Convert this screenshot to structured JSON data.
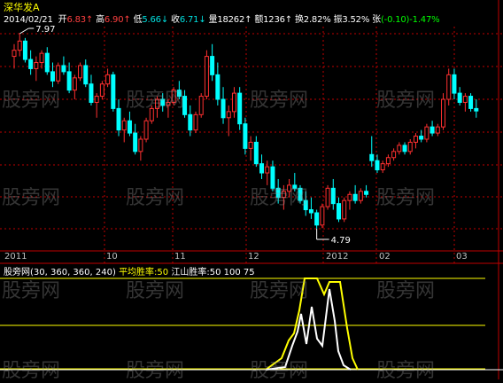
{
  "stock": {
    "name": "深华发A",
    "date": "2014/02/21"
  },
  "quote": [
    {
      "label": "开",
      "value": "6.83",
      "arrow": "↑",
      "color": "#ff4040"
    },
    {
      "label": "高",
      "value": "6.90",
      "arrow": "↑",
      "color": "#ff4040"
    },
    {
      "label": "低",
      "value": "5.66",
      "arrow": "↓",
      "color": "#00e0e0"
    },
    {
      "label": "收",
      "value": "6.71",
      "arrow": "↓",
      "color": "#00e0e0"
    },
    {
      "label": "量",
      "value": "18262",
      "arrow": "↑",
      "color": "#ffffff"
    },
    {
      "label": "额",
      "value": "1236",
      "arrow": "↑",
      "color": "#ffffff"
    },
    {
      "label": "换",
      "value": "2.82%",
      "arrow": "",
      "color": "#ffffff"
    },
    {
      "label": "振",
      "value": "3.52%",
      "arrow": "",
      "color": "#ffffff"
    },
    {
      "label": "张",
      "value": "(-0.10)-1.47%",
      "arrow": "",
      "color": "#00ff00"
    }
  ],
  "annotations": {
    "high": "7.97",
    "low": "4.79"
  },
  "date_axis": [
    "2011",
    "10",
    "11",
    "12",
    "2012",
    "02",
    "03"
  ],
  "indicator": {
    "name": "股旁网",
    "params": "(30, 360, 360, 240)",
    "line1_label": "平均胜率:50",
    "line2_label": "江山胜率:50 100 75"
  },
  "watermark": "股旁网",
  "colors": {
    "up": "#ff3030",
    "down": "#00ffff",
    "grid": "#c00000",
    "line_yellow": "#ffff00",
    "line_white": "#ffffff"
  },
  "chart_data": {
    "type": "candlestick",
    "price_high": 7.97,
    "price_low": 4.79,
    "candles": [
      [
        7.6,
        7.8,
        7.4,
        7.7
      ],
      [
        7.7,
        7.97,
        7.6,
        7.85
      ],
      [
        7.85,
        7.9,
        7.5,
        7.55
      ],
      [
        7.55,
        7.7,
        7.3,
        7.4
      ],
      [
        7.4,
        7.6,
        7.2,
        7.5
      ],
      [
        7.5,
        7.7,
        7.4,
        7.65
      ],
      [
        7.65,
        7.75,
        7.3,
        7.35
      ],
      [
        7.35,
        7.5,
        7.1,
        7.2
      ],
      [
        7.2,
        7.5,
        7.15,
        7.45
      ],
      [
        7.45,
        7.6,
        7.3,
        7.35
      ],
      [
        7.35,
        7.5,
        7.0,
        7.05
      ],
      [
        7.05,
        7.3,
        6.9,
        7.25
      ],
      [
        7.25,
        7.5,
        7.2,
        7.45
      ],
      [
        7.45,
        7.55,
        7.1,
        7.15
      ],
      [
        7.15,
        7.3,
        6.8,
        6.85
      ],
      [
        6.85,
        7.0,
        6.6,
        6.95
      ],
      [
        6.95,
        7.2,
        6.9,
        7.15
      ],
      [
        7.15,
        7.4,
        7.1,
        7.3
      ],
      [
        7.3,
        7.35,
        6.7,
        6.75
      ],
      [
        6.75,
        6.9,
        6.3,
        6.4
      ],
      [
        6.4,
        6.6,
        6.2,
        6.55
      ],
      [
        6.55,
        6.7,
        6.3,
        6.35
      ],
      [
        6.35,
        6.5,
        6.0,
        6.05
      ],
      [
        6.05,
        6.3,
        5.9,
        6.25
      ],
      [
        6.25,
        6.6,
        6.2,
        6.55
      ],
      [
        6.55,
        6.8,
        6.5,
        6.75
      ],
      [
        6.75,
        6.95,
        6.6,
        6.9
      ],
      [
        6.9,
        7.0,
        6.7,
        6.8
      ],
      [
        6.8,
        6.9,
        6.6,
        6.85
      ],
      [
        6.85,
        7.1,
        6.8,
        7.05
      ],
      [
        7.05,
        7.2,
        6.9,
        6.95
      ],
      [
        6.95,
        7.05,
        6.6,
        6.65
      ],
      [
        6.65,
        6.8,
        6.3,
        6.4
      ],
      [
        6.4,
        6.7,
        6.35,
        6.65
      ],
      [
        6.65,
        7.0,
        6.6,
        6.95
      ],
      [
        6.95,
        7.7,
        6.9,
        7.6
      ],
      [
        7.6,
        7.8,
        7.2,
        7.3
      ],
      [
        7.3,
        7.5,
        6.8,
        6.9
      ],
      [
        6.9,
        7.1,
        6.5,
        6.6
      ],
      [
        6.6,
        6.8,
        6.3,
        6.7
      ],
      [
        6.7,
        7.1,
        6.6,
        7.0
      ],
      [
        7.0,
        7.1,
        6.4,
        6.5
      ],
      [
        6.5,
        6.6,
        6.0,
        6.1
      ],
      [
        6.1,
        6.3,
        5.9,
        6.2
      ],
      [
        6.2,
        6.3,
        5.8,
        5.85
      ],
      [
        5.85,
        6.0,
        5.6,
        5.7
      ],
      [
        5.7,
        5.9,
        5.5,
        5.8
      ],
      [
        5.8,
        5.9,
        5.4,
        5.45
      ],
      [
        5.45,
        5.6,
        5.2,
        5.3
      ],
      [
        5.3,
        5.5,
        5.1,
        5.4
      ],
      [
        5.4,
        5.6,
        5.3,
        5.5
      ],
      [
        5.5,
        5.7,
        5.4,
        5.45
      ],
      [
        5.45,
        5.5,
        5.2,
        5.25
      ],
      [
        5.25,
        5.4,
        5.0,
        5.1
      ],
      [
        5.1,
        5.3,
        4.95,
        5.05
      ],
      [
        5.05,
        5.1,
        4.79,
        4.85
      ],
      [
        4.85,
        5.2,
        4.8,
        5.15
      ],
      [
        5.15,
        5.5,
        5.1,
        5.45
      ],
      [
        5.45,
        5.6,
        5.1,
        5.2
      ],
      [
        5.2,
        5.3,
        4.9,
        4.95
      ],
      [
        4.95,
        5.3,
        4.9,
        5.25
      ],
      [
        5.25,
        5.4,
        5.1,
        5.35
      ],
      [
        5.35,
        5.5,
        5.2,
        5.25
      ],
      [
        5.25,
        5.45,
        5.2,
        5.4
      ],
      [
        5.4,
        5.5,
        5.3,
        5.35
      ],
      [
        6.0,
        6.3,
        5.8,
        5.9
      ],
      [
        5.9,
        6.0,
        5.7,
        5.75
      ],
      [
        5.75,
        5.9,
        5.7,
        5.85
      ],
      [
        5.85,
        6.0,
        5.8,
        5.95
      ],
      [
        5.95,
        6.1,
        5.9,
        6.05
      ],
      [
        6.05,
        6.2,
        6.0,
        6.15
      ],
      [
        6.15,
        6.2,
        6.0,
        6.05
      ],
      [
        6.05,
        6.25,
        6.0,
        6.2
      ],
      [
        6.2,
        6.35,
        6.1,
        6.3
      ],
      [
        6.3,
        6.4,
        6.2,
        6.25
      ],
      [
        6.25,
        6.5,
        6.2,
        6.45
      ],
      [
        6.45,
        6.55,
        6.3,
        6.35
      ],
      [
        6.35,
        6.5,
        6.3,
        6.45
      ],
      [
        6.45,
        7.0,
        6.4,
        6.9
      ],
      [
        6.9,
        7.4,
        6.8,
        7.3
      ],
      [
        7.3,
        7.4,
        6.9,
        7.0
      ],
      [
        7.0,
        7.1,
        6.8,
        6.85
      ],
      [
        6.85,
        7.0,
        6.7,
        6.95
      ],
      [
        6.95,
        7.0,
        6.7,
        6.75
      ],
      [
        6.75,
        6.9,
        6.6,
        6.71
      ]
    ]
  }
}
